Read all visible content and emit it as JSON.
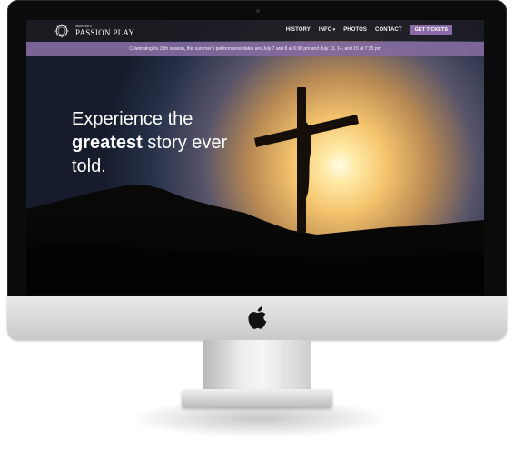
{
  "nav": {
    "brand_sub": "Manitoba's",
    "brand_name": "PASSION PLAY",
    "history": "HISTORY",
    "info": "INFO",
    "photos": "PHOTOS",
    "contact": "CONTACT",
    "tickets": "GET TICKETS"
  },
  "announcement": "Celebrating its 19th season, this summer's performance dates are July 7 and 8 at 6:30 pm and July 13, 14, and 15 at 7:30 pm",
  "hero": {
    "line1": "Experience the",
    "bold": "greatest",
    "line2_rest": "story ever",
    "line3": "told."
  },
  "colors": {
    "accent": "#8b6aa8",
    "announcement_bg": "#826a9e",
    "navbar_bg": "#1c1c22"
  },
  "icons": {
    "brand": "crown-of-thorns-icon",
    "chin": "apple-logo-icon"
  }
}
